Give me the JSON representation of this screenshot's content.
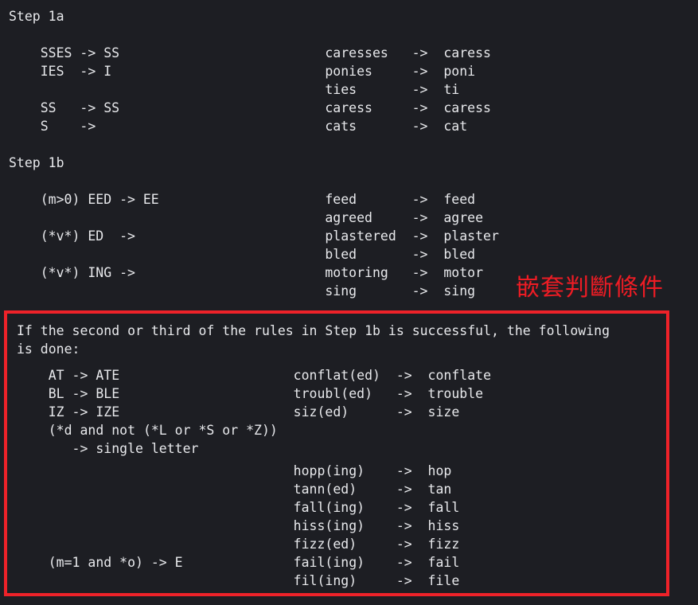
{
  "theme": {
    "background": "#1d1e23",
    "text_color": "#e8e9ec",
    "highlight_color": "#ee2229",
    "annotation_color": "#ee1c24"
  },
  "sections": {
    "step1a": {
      "heading": "Step 1a",
      "rules": "    SSES -> SS\n    IES  -> I\n\n    SS   -> SS\n    S    ->",
      "examples": "                                        caresses   ->  caress\n                                        ponies     ->  poni\n                                        ties       ->  ti\n                                        caress     ->  caress\n                                        cats       ->  cat"
    },
    "step1b": {
      "heading": "Step 1b",
      "rules": "    (m>0) EED -> EE\n\n    (*v*) ED  ->\n\n    (*v*) ING ->",
      "examples": "                                        feed       ->  feed\n                                        agreed     ->  agree\n                                        plastered  ->  plaster\n                                        bled       ->  bled\n                                        motoring   ->  motor\n                                        sing       ->  sing"
    }
  },
  "annotation": {
    "cjk_note": "嵌套判斷條件"
  },
  "highlight_box": {
    "intro": "If the second or third of the rules in Step 1b is successful, the following\nis done:",
    "rules": "    AT -> ATE\n    BL -> BLE\n    IZ -> IZE\n    (*d and not (*L or *S or *Z))\n       -> single letter",
    "examples_group_1": "                                   conflat(ed)  ->  conflate\n                                   troubl(ed)   ->  trouble\n                                   siz(ed)      ->  size",
    "examples_group_2": "                                   hopp(ing)    ->  hop\n                                   tann(ed)     ->  tan\n                                   fall(ing)    ->  fall\n                                   hiss(ing)    ->  hiss\n                                   fizz(ed)     ->  fizz\n                                   fail(ing)    ->  fail\n                                   fil(ing)     ->  file",
    "final_rule": "    (m=1 and *o) -> E"
  }
}
